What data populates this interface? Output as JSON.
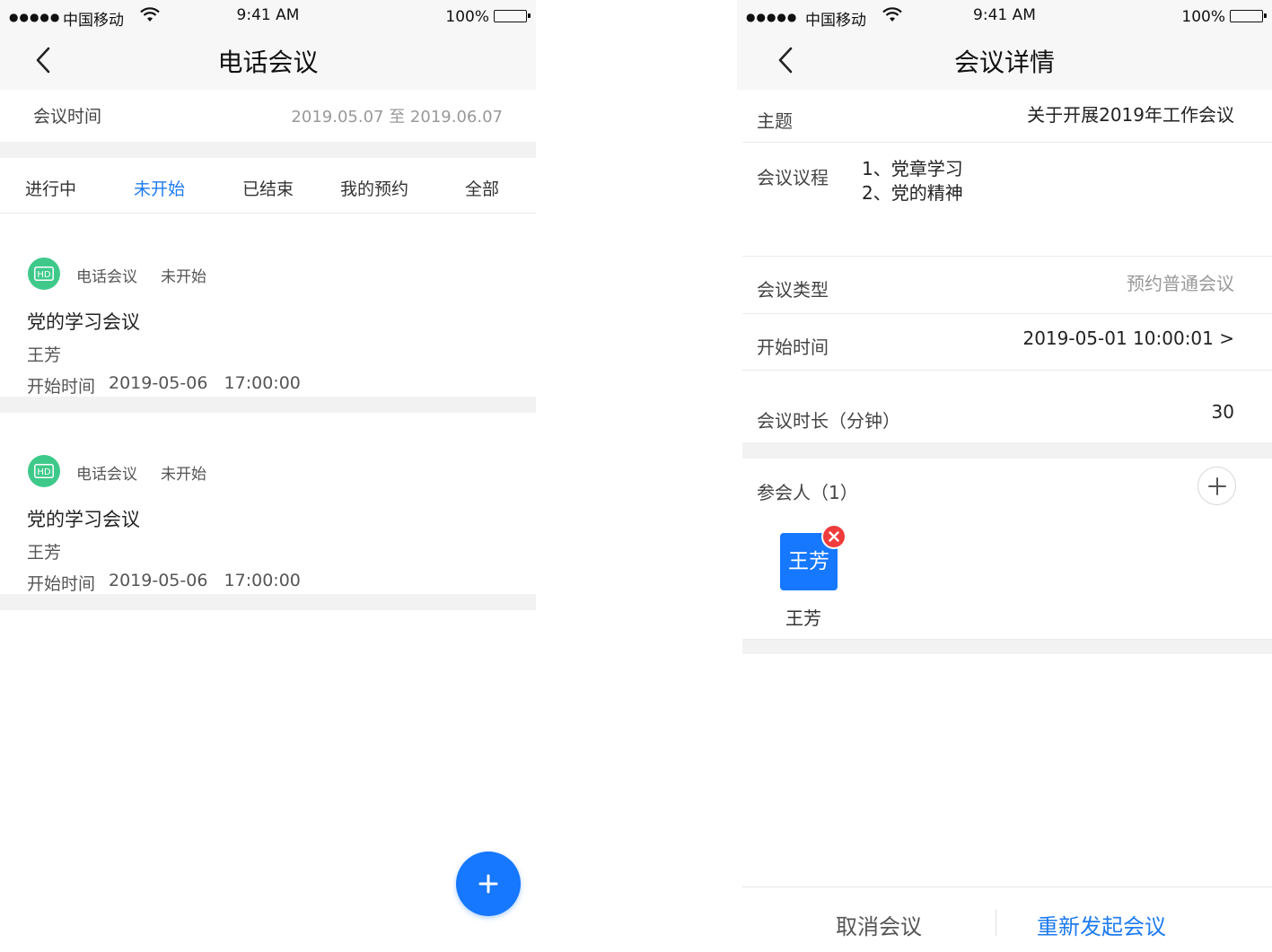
{
  "status_bar": {
    "signal": "●●●●●",
    "carrier": "中国移动",
    "time": "9:41 AM",
    "battery_percent": "100%",
    "battery_level": 1.0
  },
  "left": {
    "nav_title": "电话会议",
    "meeting_time_label": "会议时间",
    "meeting_time_value": "2019.05.07 至 2019.06.07",
    "tabs": [
      {
        "label": "进行中",
        "active": false
      },
      {
        "label": "未开始",
        "active": true
      },
      {
        "label": "已结束",
        "active": false
      },
      {
        "label": "我的预约",
        "active": false
      },
      {
        "label": "全部",
        "active": false
      }
    ],
    "meetings": [
      {
        "badge": "HD",
        "type": "电话会议",
        "status": "未开始",
        "name": "党的学习会议",
        "host": "王芳",
        "start_label": "开始时间",
        "start_value": "2019-05-06   17:00:00"
      },
      {
        "badge": "HD",
        "type": "电话会议",
        "status": "未开始",
        "name": "党的学习会议",
        "host": "王芳",
        "start_label": "开始时间",
        "start_value": "2019-05-06   17:00:00"
      }
    ]
  },
  "right": {
    "nav_title": "会议详情",
    "subject_label": "主题",
    "subject_value": "关于开展2019年工作会议",
    "agenda_label": "会议议程",
    "agenda_items": [
      "1、党章学习",
      "2、党的精神"
    ],
    "type_label": "会议类型",
    "type_value": "预约普通会议",
    "start_label": "开始时间",
    "start_value": "2019-05-01 10:00:01 >",
    "duration_label": "会议时长（分钟）",
    "duration_value": "30",
    "participants_label": "参会人（1）",
    "participants": [
      {
        "avatar_text": "王芳",
        "name": "王芳"
      }
    ],
    "cancel_label": "取消会议",
    "restart_label": "重新发起会议"
  },
  "colors": {
    "accent": "#1677ff",
    "tab_active": "#1e7bf0",
    "hd_badge": "#3ec98a",
    "remove": "#f03c3c"
  }
}
